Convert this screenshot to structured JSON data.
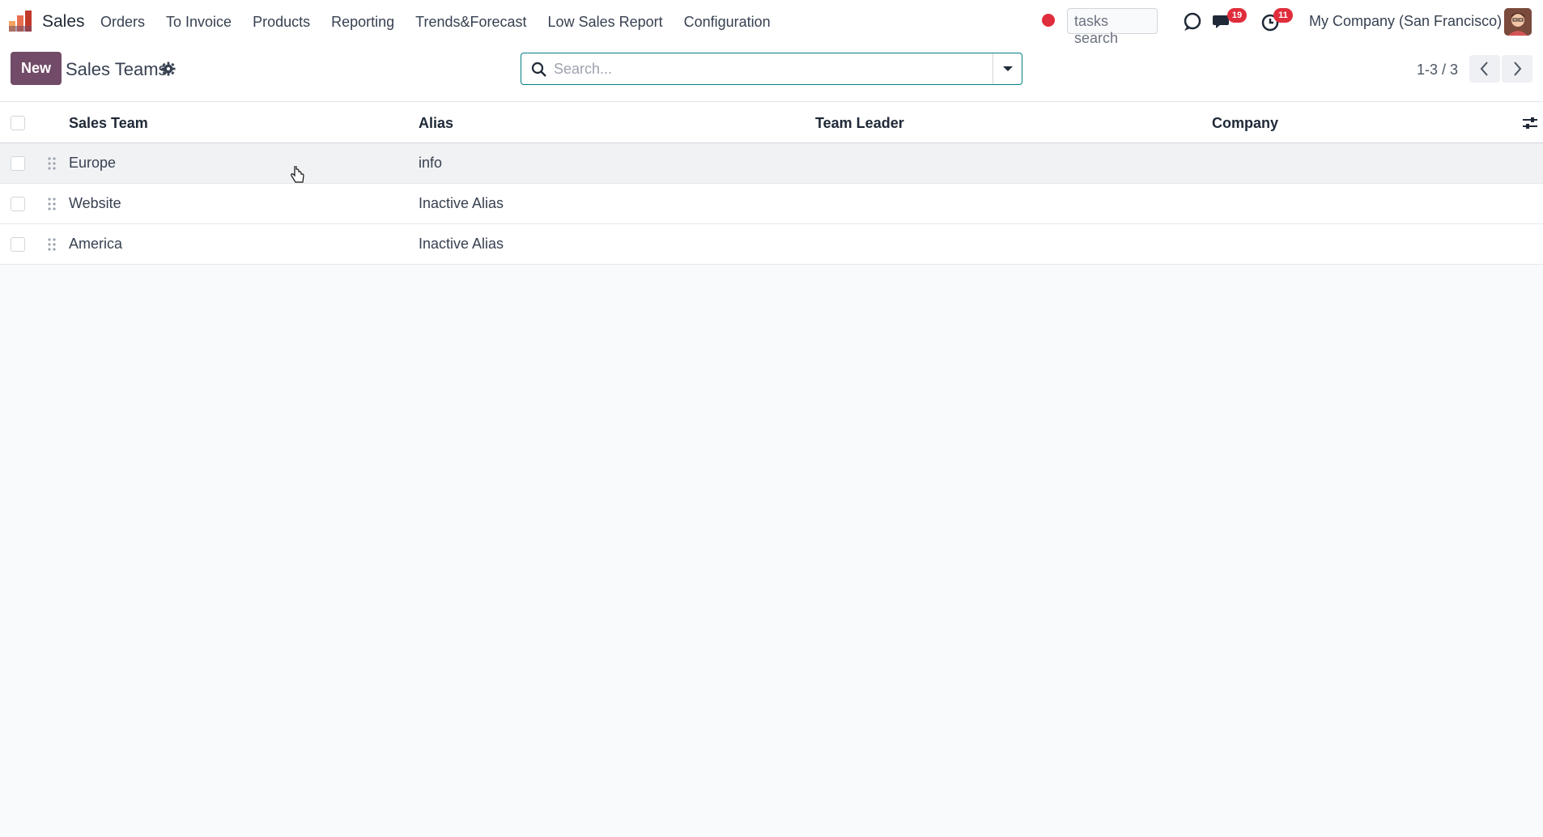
{
  "app": {
    "name": "Sales",
    "logo_icon": "sales-logo-icon"
  },
  "menu": [
    {
      "label": "Orders"
    },
    {
      "label": "To Invoice"
    },
    {
      "label": "Products"
    },
    {
      "label": "Reporting"
    },
    {
      "label": "Trends&Forecast"
    },
    {
      "label": "Low Sales Report"
    },
    {
      "label": "Configuration"
    }
  ],
  "systray": {
    "tasks_search_placeholder": "tasks search",
    "messages_count": "19",
    "activities_count": "11",
    "company": "My Company (San Francisco)"
  },
  "control": {
    "new_label": "New",
    "title": "Sales Teams",
    "search_placeholder": "Search...",
    "pager": "1-3 / 3"
  },
  "table": {
    "columns": [
      "Sales Team",
      "Alias",
      "Team Leader",
      "Company"
    ],
    "rows": [
      {
        "team": "Europe",
        "alias": "info",
        "leader": "",
        "company": ""
      },
      {
        "team": "Website",
        "alias": "Inactive Alias",
        "leader": "",
        "company": ""
      },
      {
        "team": "America",
        "alias": "Inactive Alias",
        "leader": "",
        "company": ""
      }
    ]
  },
  "colors": {
    "brand": "#714b67",
    "accent": "#017e84",
    "badge": "#e02d3c"
  }
}
